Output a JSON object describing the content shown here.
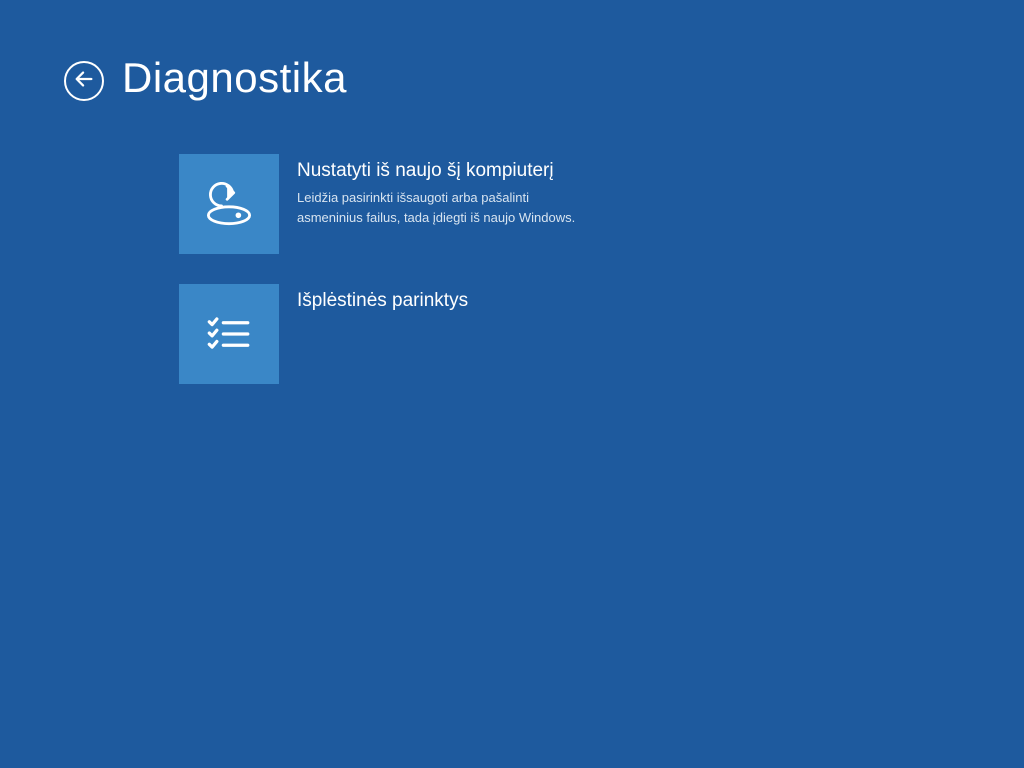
{
  "header": {
    "title": "Diagnostika"
  },
  "options": [
    {
      "title": "Nustatyti iš naujo šį kompiuterį",
      "description": "Leidžia pasirinkti išsaugoti arba pašalinti asmeninius failus, tada įdiegti iš naujo Windows."
    },
    {
      "title": "Išplėstinės parinktys",
      "description": ""
    }
  ]
}
